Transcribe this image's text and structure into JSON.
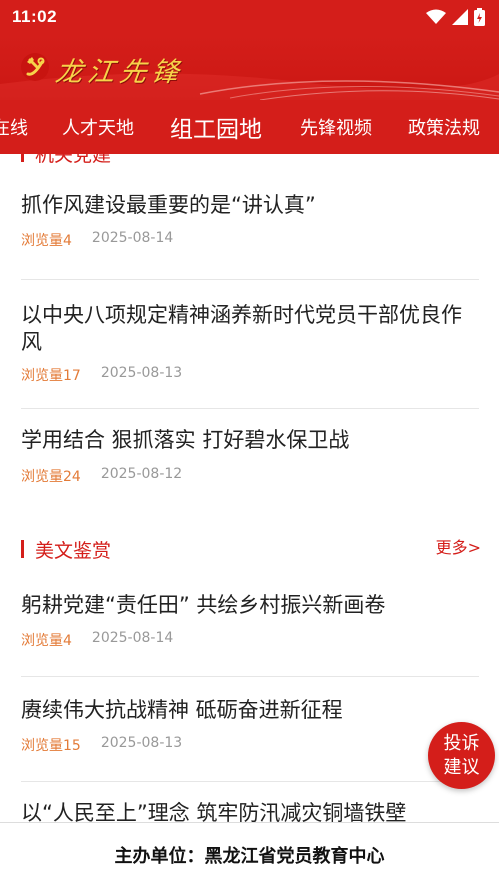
{
  "status_bar": {
    "time": "11:02"
  },
  "header": {
    "brand_title": "龙江先锋",
    "brand_color": "#d41e1a",
    "title_color": "#f7d34a"
  },
  "tabs": [
    {
      "label": "在线"
    },
    {
      "label": "人才天地"
    },
    {
      "label": "组工园地",
      "active": true
    },
    {
      "label": "先锋视频"
    },
    {
      "label": "政策法规"
    }
  ],
  "section_top": {
    "title_partial": "机关党建",
    "articles": [
      {
        "title": "抓作风建设最重要的是“讲认真”",
        "views": "浏览量4",
        "date": "2025-08-14"
      },
      {
        "title": "以中央八项规定精神涵养新时代党员干部优良作风",
        "views": "浏览量17",
        "date": "2025-08-13"
      },
      {
        "title": "学用结合 狠抓落实 打好碧水保卫战",
        "views": "浏览量24",
        "date": "2025-08-12"
      }
    ]
  },
  "section_meiwen": {
    "title": "美文鉴赏",
    "more": "更多>",
    "articles": [
      {
        "title": "躬耕党建“责任田” 共绘乡村振兴新画卷",
        "views": "浏览量4",
        "date": "2025-08-14"
      },
      {
        "title": "赓续伟大抗战精神 砥砺奋进新征程",
        "views": "浏览量15",
        "date": "2025-08-13"
      },
      {
        "title": "以“人民至上”理念 筑牢防汛减灾铜墙铁壁",
        "views": "",
        "date": ""
      }
    ]
  },
  "fab": {
    "line1": "投诉",
    "line2": "建议"
  },
  "footer": {
    "text": "主办单位：黑龙江省党员教育中心"
  },
  "icons": [
    "wifi-icon",
    "signal-icon",
    "battery-icon",
    "party-emblem-icon"
  ]
}
